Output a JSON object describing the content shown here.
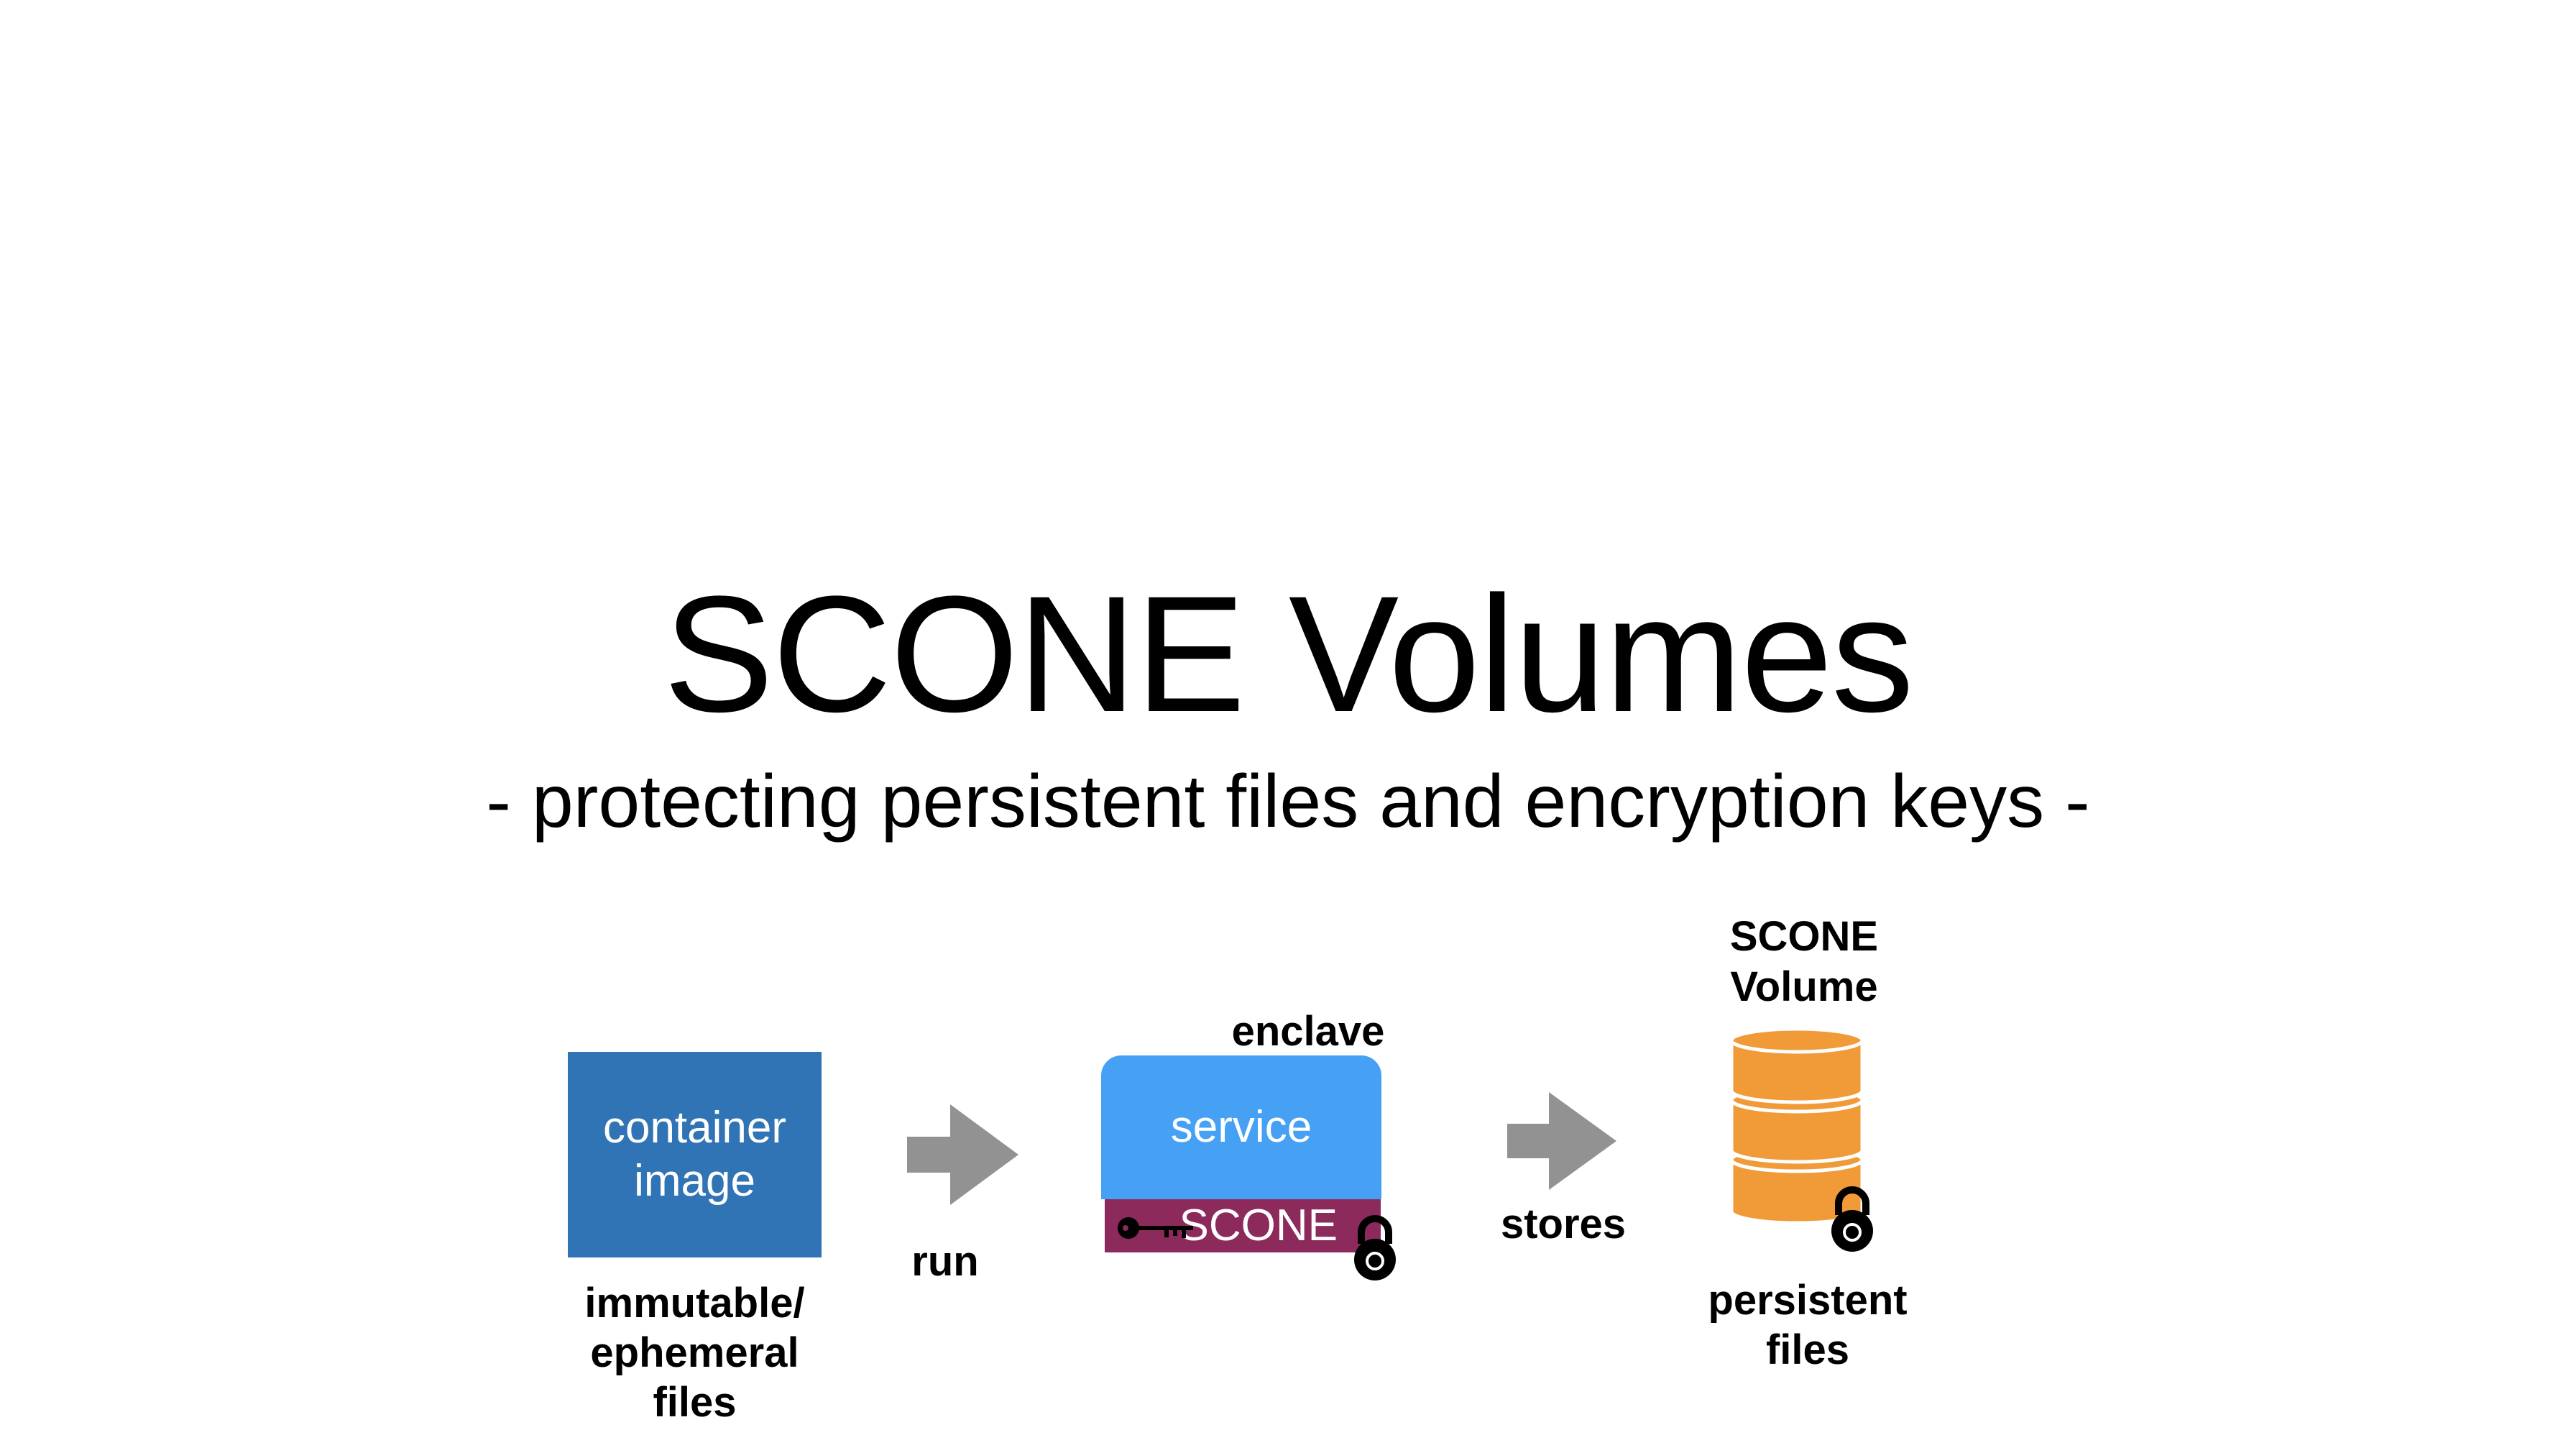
{
  "title": "SCONE Volumes",
  "subtitle": "- protecting persistent files and encryption keys -",
  "diagram": {
    "container_image": {
      "line1": "container",
      "line2": "image",
      "caption_line1": "immutable/",
      "caption_line2": "ephemeral",
      "caption_line3": "files",
      "color": "#3174b6"
    },
    "run_label": "run",
    "enclave_label": "enclave",
    "service": {
      "label": "service",
      "color": "#46a1f5"
    },
    "scone_bar": {
      "label": "SCONE",
      "color": "#8c2a5b"
    },
    "stores_label": "stores",
    "volume": {
      "title_line1": "SCONE",
      "title_line2": "Volume",
      "caption_line1": "persistent",
      "caption_line2": "files",
      "color": "#f19a38"
    },
    "arrow_color": "#929292",
    "icons": [
      "arrow-right-icon",
      "key-icon",
      "padlock-icon",
      "database-icon"
    ]
  }
}
